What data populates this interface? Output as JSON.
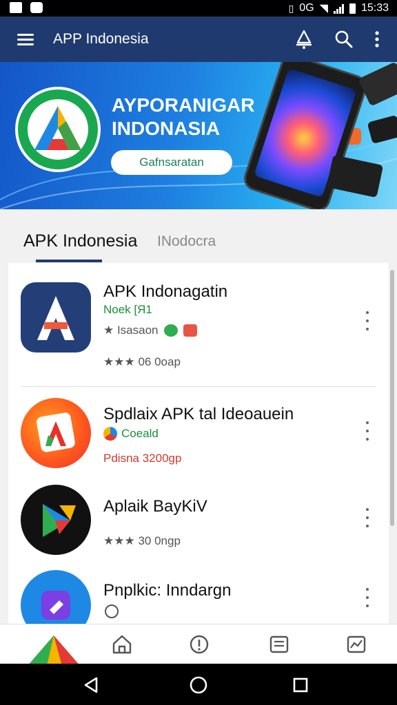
{
  "status_bar": {
    "time": "15:33",
    "network": "0G"
  },
  "app_bar": {
    "title": "APP Indonesia",
    "icons": [
      "menu-icon",
      "notification-icon",
      "search-icon",
      "more-vertical-icon"
    ]
  },
  "banner": {
    "headline_line1": "AYPORANIGAR",
    "headline_line2": "INDONASIA",
    "button_label": "Gafnsaratan"
  },
  "tabs": [
    {
      "label": "APK Indonesia",
      "active": true
    },
    {
      "label": "INodocra",
      "active": false
    }
  ],
  "apps": [
    {
      "name": "APK Indonagatin",
      "developer": "Noek [Я1",
      "meta": "★ Isasaon",
      "rating_text": "★★★ 06 0oap",
      "icon": "apk-a-logo"
    },
    {
      "name": "Spdlaix APK tal Ideoauein",
      "developer": "Coeald",
      "meta": "Pdisna 3200gp",
      "rating_text": "",
      "icon": "orange-a-logo"
    },
    {
      "name": "Aplaik BayKiV",
      "developer": "",
      "meta": "",
      "rating_text": "★★★ 30 0ngp",
      "icon": "play-logo"
    },
    {
      "name": "Pnplkic: Inndargn",
      "developer": "",
      "meta": "",
      "rating_text": "",
      "icon": "blue-app-logo"
    }
  ],
  "bottom_nav": [
    "home-icon",
    "info-icon",
    "inbox-icon",
    "stats-icon"
  ],
  "colors": {
    "app_bar": "#1f3a6e",
    "accent_green": "#1b8f3a",
    "star_red": "#e0303e"
  }
}
